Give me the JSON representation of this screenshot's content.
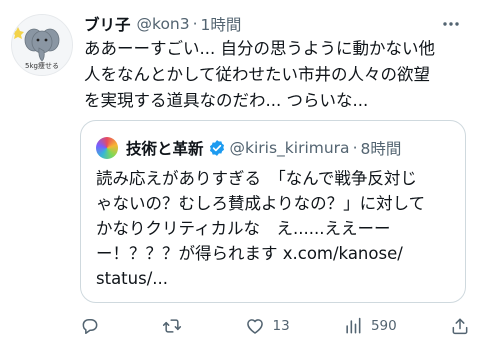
{
  "tweet": {
    "author_name": "ブリ子",
    "handle": "@kon3",
    "separator": "·",
    "time": "1時間",
    "avatar_caption": "5kg痩せる",
    "text": "ああーーすごい... 自分の思うように動かない他\n人をなんとかして従わせたい市井の人々の欲望\nを実現する道具なのだわ... つらいな..."
  },
  "quote": {
    "author_name": "技術と革新",
    "handle": "@kiris_kirimura",
    "separator": "·",
    "time": "8時間",
    "text": "読み応えがありすぎる　「なんで戦争反対じ\nゃないの？むしろ賛成よりなの？」に対して\nかなりクリティカルな　え......ええーー\nー！？？？が得られます x.com/kanose/\nstatus/..."
  },
  "actions": {
    "replies": "",
    "retweets": "",
    "likes": "13",
    "views": "590"
  },
  "icons": {
    "more": "more-dots-icon",
    "verified": "verified-badge-icon",
    "reply": "reply-icon",
    "retweet": "retweet-icon",
    "like": "heart-icon",
    "views": "views-chart-icon",
    "share": "share-icon"
  },
  "colors": {
    "text": "#0f1419",
    "secondary": "#536471",
    "verified_blue": "#1d9bf0",
    "border": "#cfd9de"
  }
}
